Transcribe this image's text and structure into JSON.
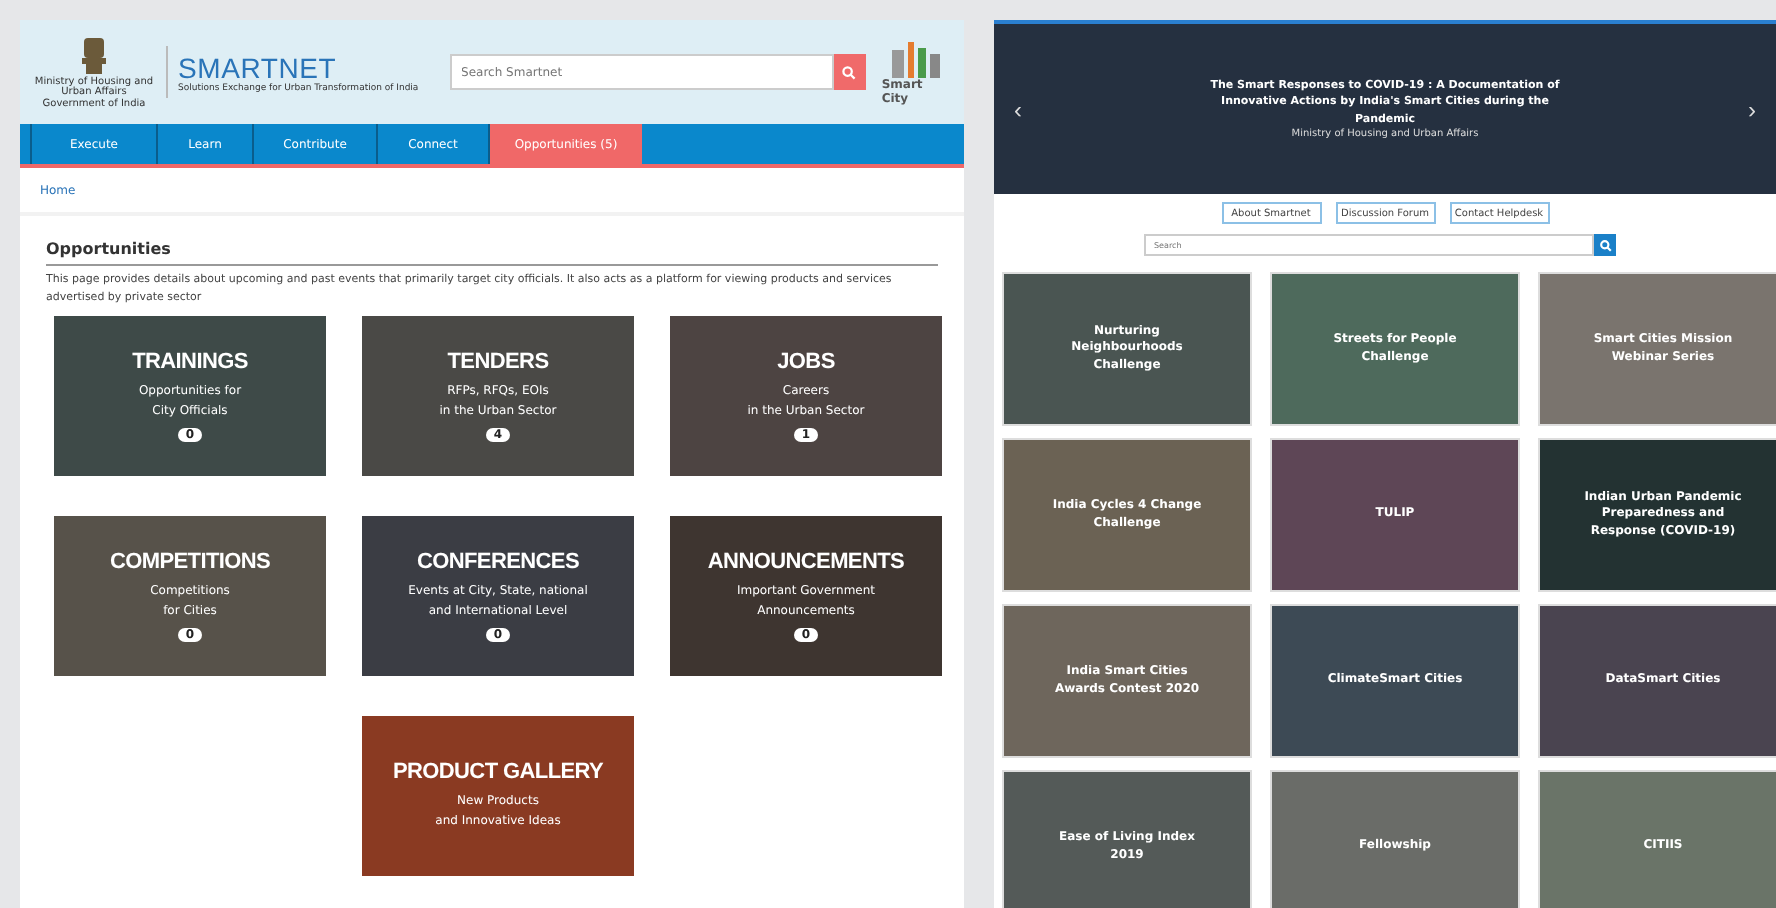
{
  "left_page": {
    "header": {
      "emblem_caption": "Ministry of Housing and Urban Affairs Government of India",
      "logo": "SMARTNET",
      "tagline": "Solutions Exchange for Urban Transformation of India",
      "search": {
        "placeholder": "Search Smartnet"
      },
      "partner_logo": "Smart City"
    },
    "nav": [
      {
        "label": "Execute",
        "selected": false
      },
      {
        "label": "Learn",
        "selected": false
      },
      {
        "label": "Contribute",
        "selected": false
      },
      {
        "label": "Connect",
        "selected": false
      },
      {
        "label": "Opportunities (5)",
        "selected": true
      }
    ],
    "breadcrumb": "Home",
    "heading": "Opportunities",
    "description": "This page provides details about upcoming and past events that primarily target city officials. It also acts as a platform for viewing products and services advertised by private sector",
    "cards": [
      {
        "title": "TRAININGS",
        "subtitle": [
          "Opportunities for",
          "City Officials"
        ],
        "count": "0"
      },
      {
        "title": "TENDERS",
        "subtitle": [
          "RFPs, RFQs, EOIs",
          "in the Urban Sector"
        ],
        "count": "4"
      },
      {
        "title": "JOBS",
        "subtitle": [
          "Careers",
          "in the Urban Sector"
        ],
        "count": "1"
      },
      {
        "title": "COMPETITIONS",
        "subtitle": [
          "Competitions",
          "for Cities"
        ],
        "count": "0"
      },
      {
        "title": "CONFERENCES",
        "subtitle": [
          "Events at City, State, national",
          "and International Level"
        ],
        "count": "0"
      },
      {
        "title": "ANNOUNCEMENTS",
        "subtitle": [
          "Important Government",
          "Announcements"
        ],
        "count": "0"
      },
      {
        "title": "PRODUCT GALLERY",
        "subtitle": [
          "New Products",
          "and Innovative Ideas"
        ]
      }
    ]
  },
  "right_page": {
    "hero": {
      "title": "The Smart Responses to COVID-19 : A Documentation of Innovative Actions by India's Smart Cities during the Pandemic",
      "caption": "Ministry of Housing and Urban Affairs",
      "prev": "‹",
      "next": "›"
    },
    "buttons": [
      "About Smartnet",
      "Discussion Forum",
      "Contact Helpdesk"
    ],
    "search": {
      "placeholder": "Search"
    },
    "tiles": [
      {
        "title": "Nurturing Neighbourhoods Challenge",
        "color": "#4a5552"
      },
      {
        "title": "Streets for People Challenge",
        "color": "#4e6a5c"
      },
      {
        "title": "Smart Cities Mission Webinar Series",
        "color": "#7a746e"
      },
      {
        "title": "India Cycles 4 Change Challenge",
        "color": "#6b6254"
      },
      {
        "title": "TULIP",
        "color": "#5e4656"
      },
      {
        "title": "Indian Urban Pandemic Preparedness and Response (COVID-19)",
        "color": "#233232"
      },
      {
        "title": "India Smart Cities Awards Contest 2020",
        "color": "#6e665c"
      },
      {
        "title": "ClimateSmart Cities",
        "color": "#3d4a55"
      },
      {
        "title": "DataSmart Cities",
        "color": "#4a4450"
      },
      {
        "title": "Ease of Living Index 2019",
        "color": "#545a58"
      },
      {
        "title": "Fellowship",
        "color": "#6a6c68"
      },
      {
        "title": "CITIIS",
        "color": "#6a7468"
      }
    ]
  }
}
